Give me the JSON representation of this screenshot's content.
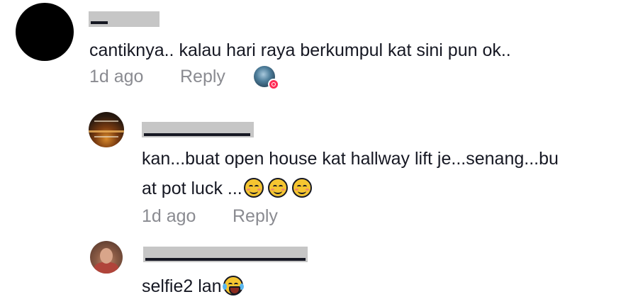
{
  "comments": [
    {
      "text": "cantiknya.. kalau hari raya berkumpul kat sini pun ok..",
      "time": "1d ago",
      "reply_label": "Reply",
      "avatar_icon": "user-avatar",
      "liked_by_creator_icon": "creator-liked-heart-icon"
    },
    {
      "text_line1": "kan...buat open house kat hallway lift je...senang...bu",
      "text_line2": "at pot luck ...",
      "emojis": [
        "smiling-face-emoji",
        "smiling-face-emoji",
        "smiling-face-emoji"
      ],
      "time": "1d ago",
      "reply_label": "Reply",
      "avatar_icon": "user-avatar"
    },
    {
      "text": "selfie2 lan",
      "emojis": [
        "face-with-tears-of-joy-emoji"
      ],
      "avatar_icon": "user-avatar"
    }
  ],
  "colors": {
    "text": "#161823",
    "meta": "#8a8b91",
    "redaction": "#c6c6c6",
    "like_badge": "#fe2c55"
  }
}
